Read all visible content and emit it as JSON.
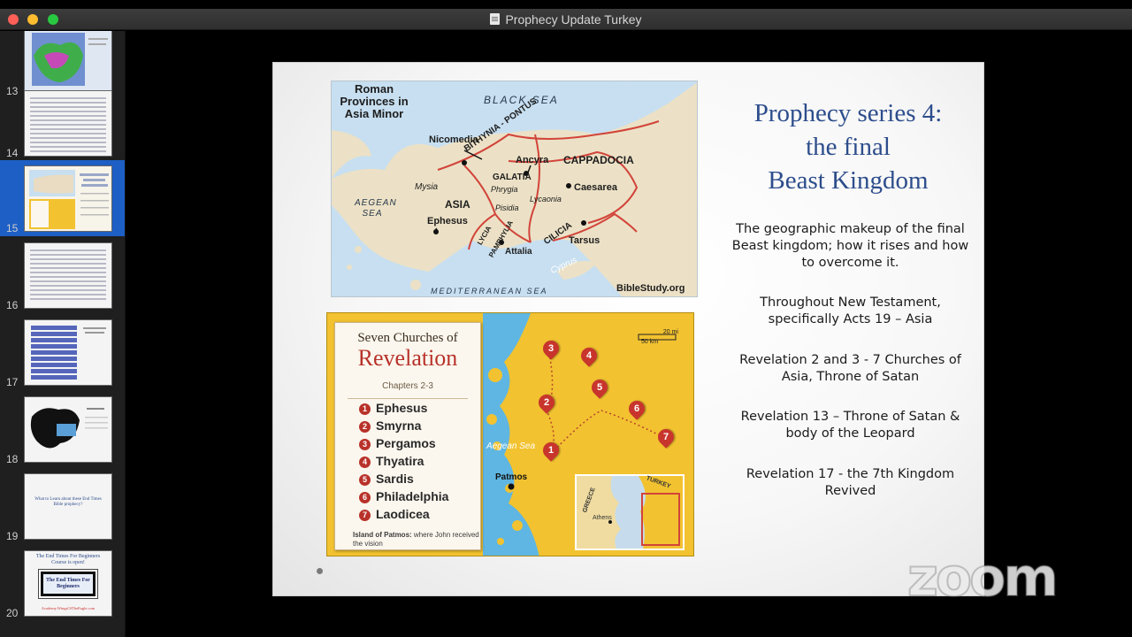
{
  "window": {
    "title": "Prophecy Update Turkey"
  },
  "sidebar": {
    "slides": [
      {
        "number": "13"
      },
      {
        "number": "14"
      },
      {
        "number": "15"
      },
      {
        "number": "16"
      },
      {
        "number": "17"
      },
      {
        "number": "18"
      },
      {
        "number": "19",
        "thumb_text": "What to Learn about these End Times Bible prophecy?"
      },
      {
        "number": "20",
        "thumb_title": "The End Times For Beginners Course is open!",
        "thumb_banner": "The End Times For Beginners",
        "thumb_url": "Academy.WingsOfTheEagle.com"
      }
    ],
    "active_slide": "15"
  },
  "slide": {
    "title_lines": [
      "Prophecy series 4:",
      "the final",
      "Beast Kingdom"
    ],
    "paragraphs": [
      "The geographic makeup of the final Beast kingdom; how it rises and how to overcome it.",
      "Throughout New Testament, specifically Acts 19 – Asia",
      "Revelation 2 and 3 - 7 Churches of Asia, Throne of Satan",
      "Revelation 13 – Throne of Satan & body of the Leopard",
      "Revelation 17 - the 7th Kingdom Revived"
    ],
    "map_roman": {
      "heading": "Roman Provinces in Asia Minor",
      "black_sea": "BLACK SEA",
      "aegean_sea": "AEGEAN SEA",
      "med_sea": "MEDITERRANEAN SEA",
      "nicomedia": "Nicomedia",
      "bithynia": "BITHYNIA - PONTUS",
      "ancyra": "Ancyra",
      "galatia": "GALATIA",
      "cappadocia": "CAPPADOCIA",
      "caesarea": "Caesarea",
      "mysia": "Mysia",
      "phrygia": "Phrygia",
      "asia": "ASIA",
      "pisidia": "Pisidia",
      "lycaonia": "Lycaonia",
      "ephesus": "Ephesus",
      "lycia": "LYCIA",
      "pamphylia": "PAMPHYLIA",
      "cilicia": "CILICIA",
      "tarsus": "Tarsus",
      "attalia": "Attalia",
      "cyprus": "Cyprus",
      "credit": "BibleStudy.org"
    },
    "map_churches": {
      "title_small": "Seven Churches of",
      "title_big": "Revelation",
      "subtitle": "Chapters 2-3",
      "churches": [
        {
          "n": "1",
          "name": "Ephesus"
        },
        {
          "n": "2",
          "name": "Smyrna"
        },
        {
          "n": "3",
          "name": "Pergamos"
        },
        {
          "n": "4",
          "name": "Thyatira"
        },
        {
          "n": "5",
          "name": "Sardis"
        },
        {
          "n": "6",
          "name": "Philadelphia"
        },
        {
          "n": "7",
          "name": "Laodicea"
        }
      ],
      "footnote_bold": "Island of Patmos:",
      "footnote_rest": "where John received the vision",
      "aegean": "Aegean Sea",
      "patmos": "Patmos",
      "scale_mi": "20 mi",
      "scale_km": "50 km",
      "inset_greece": "GREECE",
      "inset_turkey": "TURKEY",
      "inset_athens": "Athens"
    }
  },
  "watermark": "zoom",
  "colors": {
    "active_slide": "#1d5fc4",
    "title_blue": "#2d4d8c",
    "revelation_red": "#b8322a",
    "map_yellow": "#f2c230"
  }
}
